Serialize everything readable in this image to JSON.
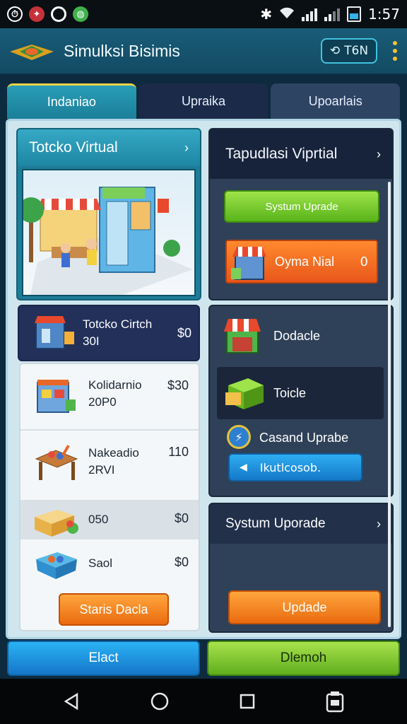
{
  "status_bar": {
    "time": "1:57",
    "left_icons": [
      "clock-icon",
      "game-icon",
      "target-icon",
      "app-icon"
    ],
    "right_icons": [
      "vibrate-icon",
      "wifi-icon",
      "signal-icon",
      "signal-icon",
      "battery-icon"
    ]
  },
  "app": {
    "title": "Simulksi Bisimis",
    "header_button": "T6N",
    "accent": "#f2c230"
  },
  "tabs": [
    {
      "label": "Indaniao"
    },
    {
      "label": "Upraika"
    },
    {
      "label": "Upoarlais"
    }
  ],
  "left_panel": {
    "title": "Totcko Virtual"
  },
  "shop_list": {
    "featured": {
      "name_line1": "Totcko Cirtch",
      "name_line2": "30I",
      "price": "$0"
    },
    "items": [
      {
        "name_line1": "Kolidarnio",
        "name_line2": "20P0",
        "price": "$30"
      },
      {
        "name_line1": "Nakeadio",
        "name_line2": "2RVI",
        "price": "110"
      },
      {
        "name_line1": "050",
        "name_line2": "",
        "price": "$0"
      },
      {
        "name_line1": "Saol",
        "name_line2": "",
        "price": "$0"
      }
    ],
    "button": "Staris Dacla"
  },
  "right_top": {
    "title": "Tapudlasi Viprtial",
    "upgrade_button": "Systum Uprade",
    "item_name": "Oyma Nial",
    "item_value": "0"
  },
  "right_mid": {
    "items": [
      {
        "label": "Dodacle"
      },
      {
        "label": "Toicle"
      },
      {
        "label": "Casand Uprabe"
      }
    ],
    "button": "Ikutlcosob."
  },
  "right_bottom": {
    "title": "Systum Uporade",
    "button": "Updade"
  },
  "bottom_actions": {
    "left": "Elact",
    "right": "Dlemoh"
  },
  "colors": {
    "header": "#1a5d78",
    "frame": "#cfe6ef",
    "orange": "#ea6b0f",
    "green": "#58b41a",
    "blue": "#1478c8"
  }
}
